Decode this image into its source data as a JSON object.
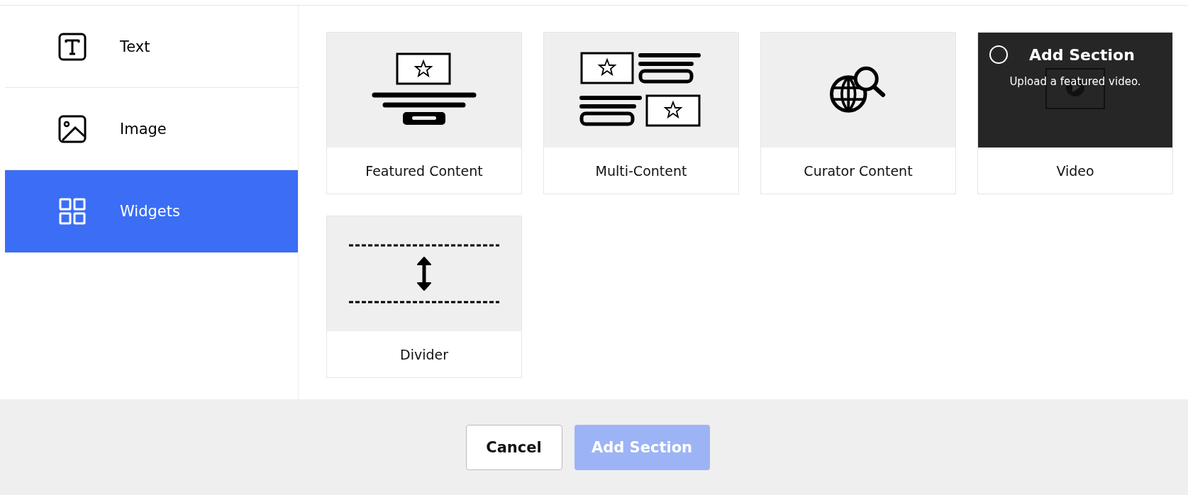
{
  "sidebar": {
    "items": [
      {
        "label": "Text",
        "kind": "text",
        "selected": false
      },
      {
        "label": "Image",
        "kind": "image",
        "selected": false
      },
      {
        "label": "Widgets",
        "kind": "widgets",
        "selected": true
      }
    ]
  },
  "cards": [
    {
      "kind": "featured",
      "label": "Featured Content"
    },
    {
      "kind": "multi",
      "label": "Multi-Content"
    },
    {
      "kind": "curator",
      "label": "Curator Content"
    },
    {
      "kind": "video",
      "label": "Video",
      "overlay_title": "Add Section",
      "overlay_text": "Upload a featured video.",
      "radio_checked": false
    },
    {
      "kind": "divider",
      "label": "Divider"
    }
  ],
  "footer": {
    "buttons": [
      {
        "label": "Cancel",
        "kind": "secondary",
        "disabled": false
      },
      {
        "label": "Add Section",
        "kind": "primary",
        "disabled": true
      }
    ]
  }
}
